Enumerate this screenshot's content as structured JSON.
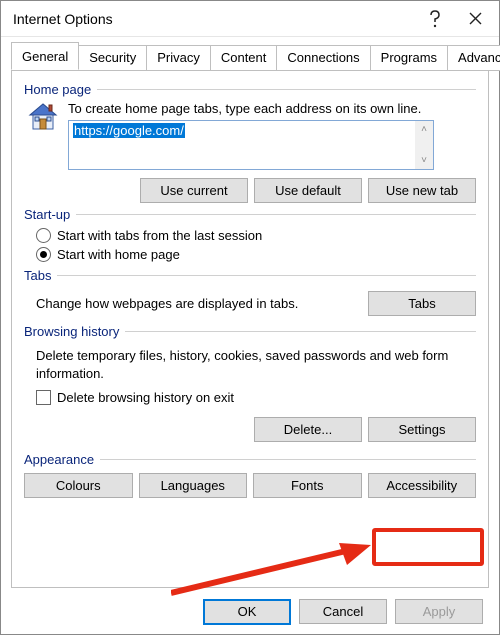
{
  "title": "Internet Options",
  "tabs": [
    "General",
    "Security",
    "Privacy",
    "Content",
    "Connections",
    "Programs",
    "Advanced"
  ],
  "active_tab": 0,
  "homepage": {
    "group_label": "Home page",
    "hint": "To create home page tabs, type each address on its own line.",
    "value": "https://google.com/",
    "buttons": {
      "use_current": "Use current",
      "use_default": "Use default",
      "use_new_tab": "Use new tab"
    }
  },
  "startup": {
    "group_label": "Start-up",
    "options": {
      "tabs_last_session": {
        "label": "Start with tabs from the last session",
        "checked": false
      },
      "home_page": {
        "label": "Start with home page",
        "checked": true
      }
    }
  },
  "tabs_group": {
    "group_label": "Tabs",
    "text": "Change how webpages are displayed in tabs.",
    "button": "Tabs"
  },
  "browsing_history": {
    "group_label": "Browsing history",
    "text": "Delete temporary files, history, cookies, saved passwords and web form information.",
    "delete_on_exit": {
      "label": "Delete browsing history on exit",
      "checked": false
    },
    "buttons": {
      "delete": "Delete...",
      "settings": "Settings"
    }
  },
  "appearance": {
    "group_label": "Appearance",
    "buttons": {
      "colours": "Colours",
      "languages": "Languages",
      "fonts": "Fonts",
      "accessibility": "Accessibility"
    }
  },
  "dialog_buttons": {
    "ok": "OK",
    "cancel": "Cancel",
    "apply": "Apply"
  },
  "annotation": {
    "highlight_target": "accessibility-button"
  }
}
